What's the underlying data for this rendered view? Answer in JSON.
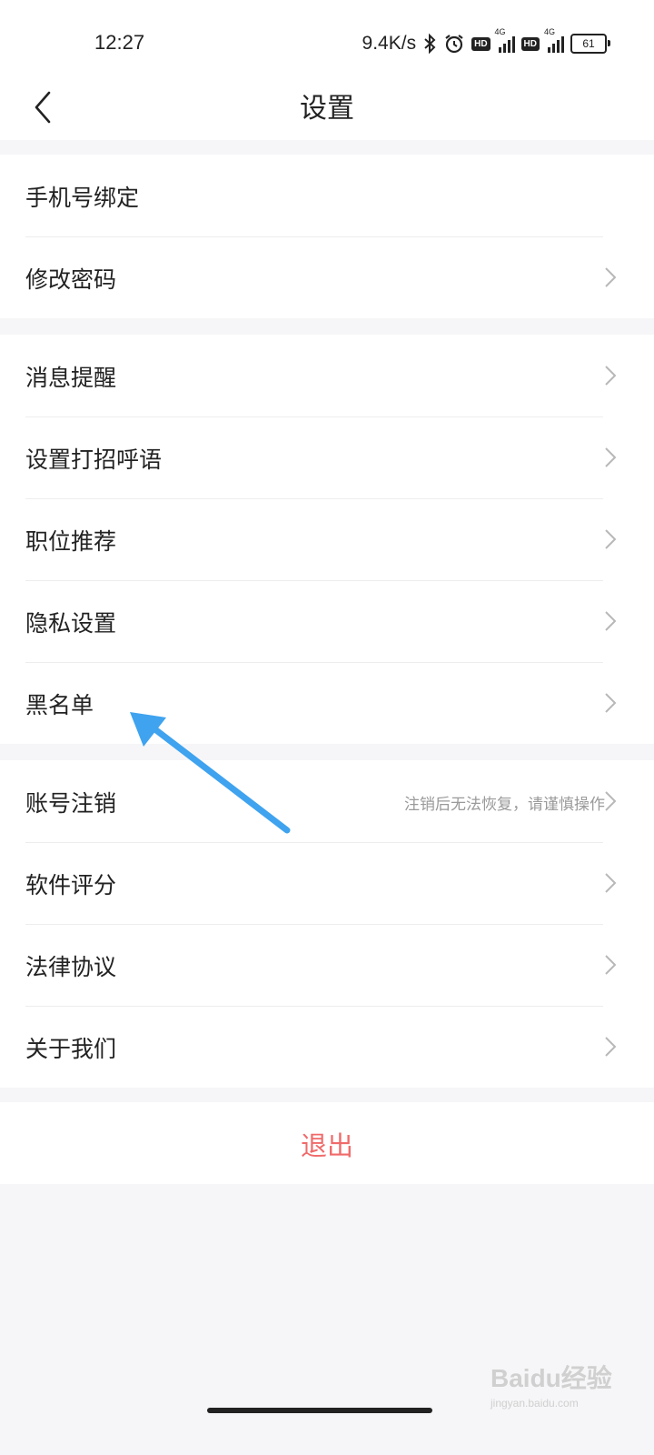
{
  "status_bar": {
    "time": "12:27",
    "net_speed": "9.4K/s",
    "hd1": "HD",
    "net1": "4G",
    "hd2": "HD",
    "net2": "4G",
    "battery": "61"
  },
  "header": {
    "title": "设置"
  },
  "groups": [
    {
      "items": [
        {
          "label": "手机号绑定",
          "chevron": false
        },
        {
          "label": "修改密码",
          "chevron": true
        }
      ]
    },
    {
      "items": [
        {
          "label": "消息提醒",
          "chevron": true
        },
        {
          "label": "设置打招呼语",
          "chevron": true
        },
        {
          "label": "职位推荐",
          "chevron": true
        },
        {
          "label": "隐私设置",
          "chevron": true
        },
        {
          "label": "黑名单",
          "chevron": true
        }
      ]
    },
    {
      "items": [
        {
          "label": "账号注销",
          "hint": "注销后无法恢复，请谨慎操作",
          "chevron": true
        },
        {
          "label": "软件评分",
          "chevron": true
        },
        {
          "label": "法律协议",
          "chevron": true
        },
        {
          "label": "关于我们",
          "chevron": true
        }
      ]
    }
  ],
  "logout_label": "退出",
  "colors": {
    "accent": "#f06a6a",
    "annotation_arrow": "#3fa3ef",
    "background": "#f6f6f8"
  },
  "watermark": {
    "logo": "Baidu经验",
    "sub": "jingyan.baidu.com"
  }
}
